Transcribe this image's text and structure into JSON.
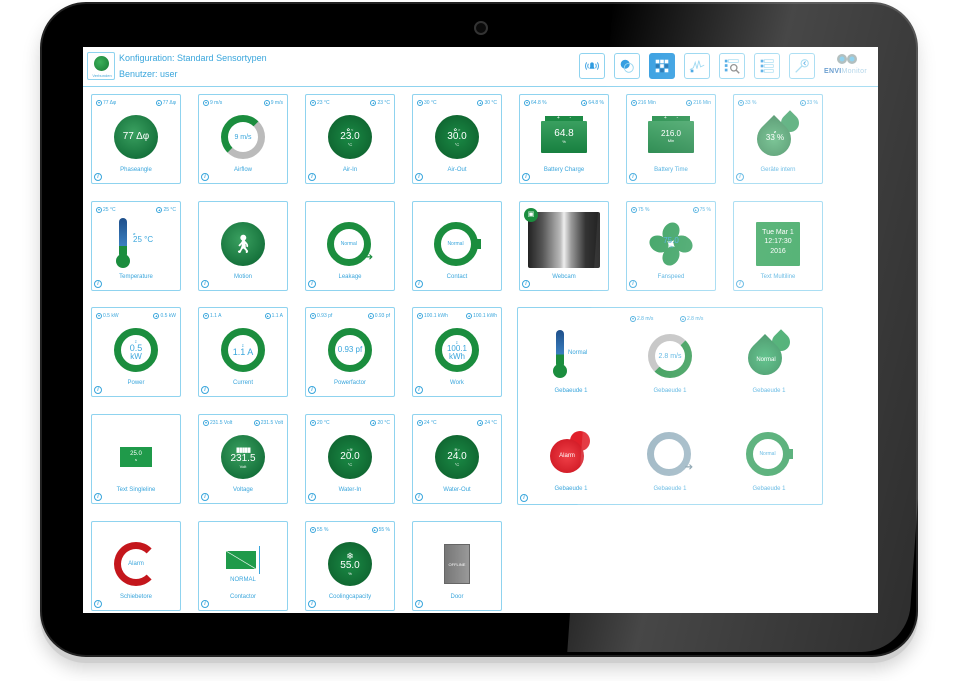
{
  "header": {
    "status_label": "Verbunden",
    "config_line": "Konfiguration: Standard Sensortypen",
    "user_line": "Benutzer: user",
    "logo_bold": "ENVI",
    "logo_light": "Monitor",
    "toolbar": [
      {
        "name": "alarm",
        "icon": "alarm-bell-icon",
        "active": false
      },
      {
        "name": "sensor-types",
        "icon": "pill-icon",
        "active": false
      },
      {
        "name": "dashboard-grid",
        "icon": "grid-icon",
        "active": true
      },
      {
        "name": "charts",
        "icon": "line-chart-icon",
        "active": false
      },
      {
        "name": "search-list",
        "icon": "list-search-icon",
        "active": false
      },
      {
        "name": "list",
        "icon": "list-icon",
        "active": false
      },
      {
        "name": "logout",
        "icon": "key-icon",
        "active": false
      }
    ]
  },
  "tiles": [
    {
      "label": "Phaseangle",
      "min": "77 Δφ",
      "max": "77 Δφ",
      "value": "77 Δφ",
      "unit": ""
    },
    {
      "label": "Airflow",
      "min": "9 m/s",
      "max": "9 m/s",
      "value": "9 m/s",
      "unit": ""
    },
    {
      "label": "Air-In",
      "min": "23 °C",
      "max": "23 °C",
      "value": "23.0",
      "unit": "°C",
      "side": "Air-In"
    },
    {
      "label": "Air-Out",
      "min": "30 °C",
      "max": "30 °C",
      "value": "30.0",
      "unit": "°C",
      "side": "Air-Out"
    },
    {
      "label": "Battery Charge",
      "min": "64.8 %",
      "max": "64.8 %",
      "value": "64.8",
      "unit": "%"
    },
    {
      "label": "Battery Time",
      "min": "216 Min",
      "max": "216 Min",
      "value": "216.0",
      "unit": "Min"
    },
    {
      "label": "Geräte intern",
      "min": "33 %",
      "max": "33 %",
      "value": "33 %",
      "unit": "ø"
    },
    {
      "label": "Temperature",
      "min": "25 °C",
      "max": "25 °C",
      "value": "25 °C",
      "unit": "ø"
    },
    {
      "label": "Motion"
    },
    {
      "label": "Leakage",
      "state": "Normal"
    },
    {
      "label": "Contact",
      "state": "Normal"
    },
    {
      "label": "Webcam"
    },
    {
      "label": "Fanspeed",
      "min": "75 %",
      "max": "75 %",
      "value": "75.0",
      "unit": "%"
    },
    {
      "label": "Text Multiline",
      "line1": "Tue Mar 1",
      "line2": "12:17:30",
      "line3": "2016"
    },
    {
      "label": "Power",
      "min": "0.5 kW",
      "max": "0.5 kW",
      "value": "0.5",
      "unit": "kW",
      "sigma": "Σ"
    },
    {
      "label": "Current",
      "min": "1.1 A",
      "max": "1.1 A",
      "value": "1.1 A",
      "unit": "",
      "sigma": "Σ"
    },
    {
      "label": "Powerfactor",
      "min": "0.93 pf",
      "max": "0.93 pf",
      "value": "0.93 pf",
      "unit": ""
    },
    {
      "label": "Work",
      "min": "100.1 kWh",
      "max": "100.1 kWh",
      "value": "100.1",
      "unit": "kWh",
      "sigma": "Σ"
    },
    {
      "label": "Text Singleline",
      "value": "25.0",
      "unit": "s"
    },
    {
      "label": "Voltage",
      "min": "231.5 Volt",
      "max": "231.5 Volt",
      "value": "231.5",
      "unit": "Volt"
    },
    {
      "label": "Water-In",
      "min": "20 °C",
      "max": "20 °C",
      "value": "20.0",
      "unit": "°C"
    },
    {
      "label": "Water-Out",
      "min": "24 °C",
      "max": "24 °C",
      "value": "24.0",
      "unit": "°C"
    },
    {
      "label": "Schiebetore",
      "state": "Alarm"
    },
    {
      "label": "Contactor",
      "state": "NORMAL"
    },
    {
      "label": "Coolingcapacity",
      "min": "55 %",
      "max": "55 %",
      "value": "55.0",
      "unit": "%"
    },
    {
      "label": "Door",
      "state": "OFFLINE"
    }
  ],
  "group": {
    "min": "2.8 m/s",
    "max": "2.8 m/s",
    "items": [
      {
        "label": "Gebaeude 1",
        "state": "Normal",
        "type": "temperature"
      },
      {
        "label": "Gebaeude 1",
        "value": "2.8 m/s",
        "type": "airflow"
      },
      {
        "label": "Gebaeude 1",
        "state": "Normal",
        "type": "humidity"
      },
      {
        "label": "Gebaeude 1",
        "state": "Alarm",
        "type": "humidity-alarm"
      },
      {
        "label": "Gebaeude 1",
        "state": "",
        "type": "leakage-offline"
      },
      {
        "label": "Gebaeude 1",
        "state": "Normal",
        "type": "contact"
      }
    ]
  },
  "info_glyph": "i",
  "down_glyph": "▾",
  "up_glyph": "▴"
}
